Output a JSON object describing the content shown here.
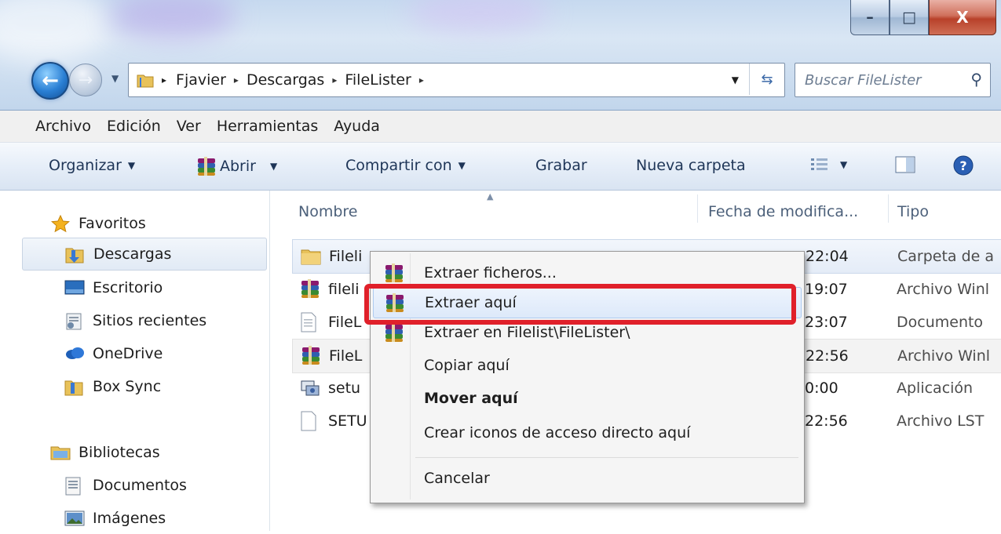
{
  "window": {
    "minimize": "–",
    "maximize": "□",
    "close": "X"
  },
  "address": {
    "crumbs": [
      "Fjavier",
      "Descargas",
      "FileLister"
    ],
    "trailing_sep": "▸"
  },
  "search": {
    "placeholder": "Buscar FileLister"
  },
  "menubar": [
    "Archivo",
    "Edición",
    "Ver",
    "Herramientas",
    "Ayuda"
  ],
  "toolbar": {
    "organize": "Organizar",
    "open": "Abrir",
    "share": "Compartir con",
    "burn": "Grabar",
    "new_folder": "Nueva carpeta"
  },
  "sidebar": {
    "favorites_header": "Favoritos",
    "favorites": [
      "Descargas",
      "Escritorio",
      "Sitios recientes",
      "OneDrive",
      "Box Sync"
    ],
    "libraries_header": "Bibliotecas",
    "libraries": [
      "Documentos",
      "Imágenes"
    ]
  },
  "columns": {
    "name": "Nombre",
    "date": "Fecha de modifica...",
    "type": "Tipo"
  },
  "files": [
    {
      "name": "Fileli",
      "date": "22:04",
      "type": "Carpeta de a"
    },
    {
      "name": "fileli",
      "date": "19:07",
      "type": "Archivo Winl"
    },
    {
      "name": "FileL",
      "date": "23:07",
      "type": "Documento"
    },
    {
      "name": "FileL",
      "date": "22:56",
      "type": "Archivo Winl"
    },
    {
      "name": "setu",
      "date": "0:00",
      "type": "Aplicación"
    },
    {
      "name": "SETU",
      "date": "22:56",
      "type": "Archivo LST"
    }
  ],
  "context_menu": {
    "items": [
      "Extraer ficheros...",
      "Extraer aquí",
      "Extraer en Filelist\\FileLister\\",
      "Copiar aquí",
      "Mover aquí",
      "Crear iconos de acceso directo aquí",
      "Cancelar"
    ]
  },
  "colors": {
    "highlight_box": "#e0202a",
    "selection": "#dde9fa",
    "title_glass": "#c6d9ef"
  }
}
